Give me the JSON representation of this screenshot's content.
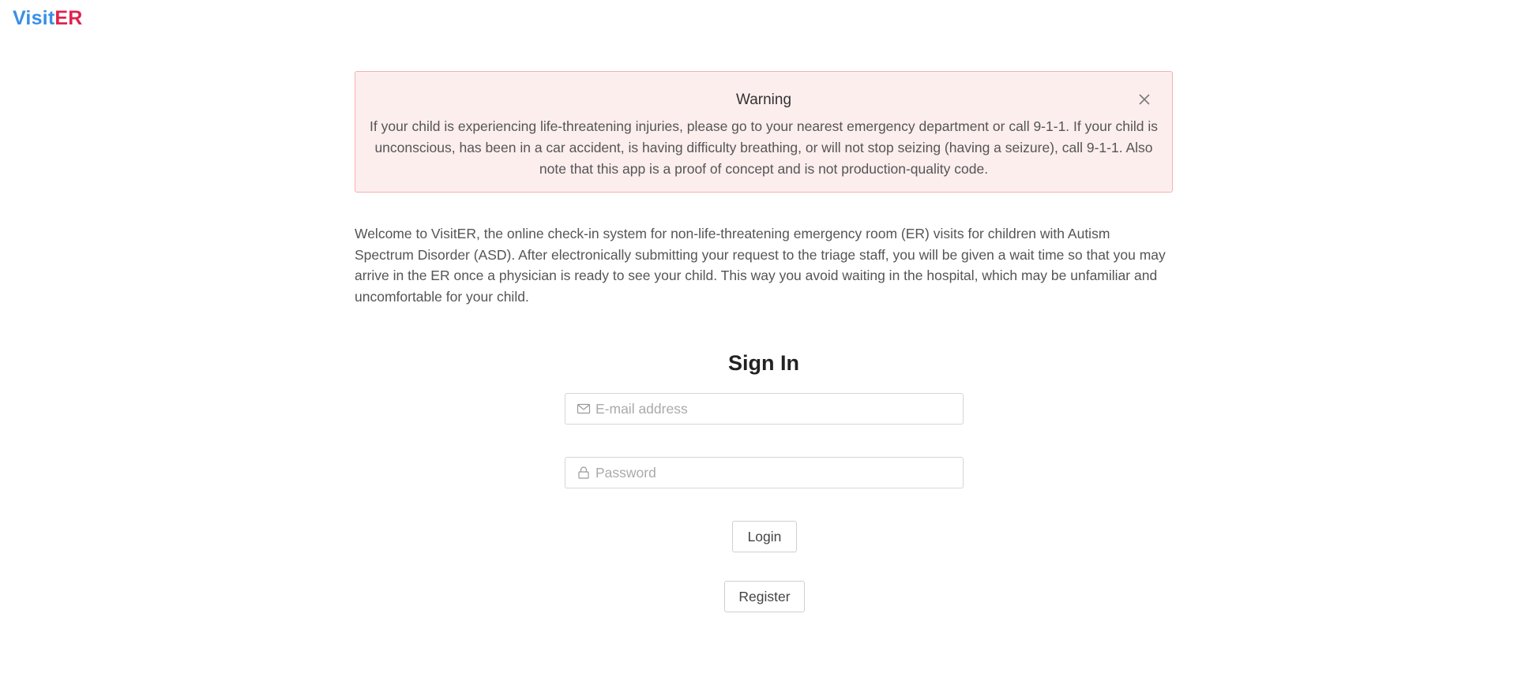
{
  "header": {
    "logo_part1": "Visit",
    "logo_part2": "ER"
  },
  "warning": {
    "title": "Warning",
    "body": "If your child is experiencing life-threatening injuries, please go to your nearest emergency department or call 9-1-1. If your child is unconscious, has been in a car accident, is having difficulty breathing, or will not stop seizing (having a seizure), call 9-1-1. Also note that this app is a proof of concept and is not production-quality code.",
    "close_icon": "close-icon"
  },
  "intro": {
    "text": "Welcome to VisitER, the online check-in system for non-life-threatening emergency room (ER) visits for children with Autism Spectrum Disorder (ASD). After electronically submitting your request to the triage staff, you will be given a wait time so that you may arrive in the ER once a physician is ready to see your child. This way you avoid waiting in the hospital, which may be unfamiliar and uncomfortable for your child."
  },
  "signin": {
    "title": "Sign In",
    "email": {
      "placeholder": "E-mail address",
      "value": "",
      "icon": "mail-icon"
    },
    "password": {
      "placeholder": "Password",
      "value": "",
      "icon": "lock-icon"
    },
    "login_label": "Login",
    "register_label": "Register"
  },
  "colors": {
    "logo_visit": "#3a8ee6",
    "logo_er": "#e0234e",
    "warning_bg": "#fdeeee",
    "warning_border": "#f3b2b2"
  }
}
